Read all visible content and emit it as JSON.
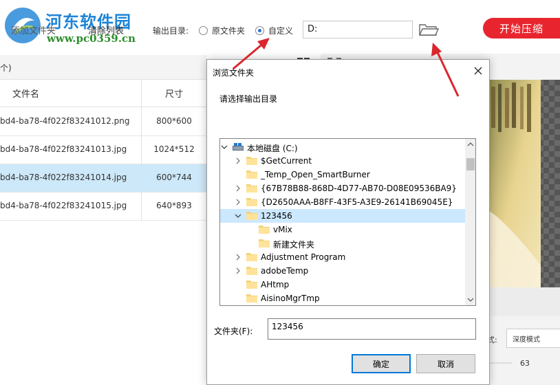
{
  "watermark": {
    "title": "河东软件园",
    "url": "www.pc0359.cn"
  },
  "toolbar": {
    "add_folder": "添加文件夹",
    "clear_list": "清除列表",
    "output_label": "输出目录:",
    "radio_original": "原文件夹",
    "radio_custom": "自定义",
    "path_value": "D:",
    "start_button": "开始压缩"
  },
  "left_panel": {
    "count_paren": "个)",
    "columns": {
      "name": "文件名",
      "size": "尺寸"
    },
    "rows": [
      {
        "name": "bd4-ba78-4f022f83241012.png",
        "size": "800*600",
        "selected": false
      },
      {
        "name": "bd4-ba78-4f022f83241013.jpg",
        "size": "1024*512",
        "selected": false
      },
      {
        "name": "bd4-ba78-4f022f83241014.jpg",
        "size": "600*744",
        "selected": true
      },
      {
        "name": "bd4-ba78-4f022f83241015.jpg",
        "size": "640*893",
        "selected": false
      }
    ]
  },
  "right_panel": {
    "mode_label": "式:",
    "mode_value": "深度模式",
    "quality_value": "63"
  },
  "dialog": {
    "title": "浏览文件夹",
    "prompt": "请选择输出目录",
    "tree": [
      {
        "label": "本地磁盘 (C:)",
        "level": 0,
        "arrow": "down",
        "icon": "drive-icon",
        "selected": false
      },
      {
        "label": "$GetCurrent",
        "level": 1,
        "arrow": "right",
        "icon": "folder-icon",
        "selected": false
      },
      {
        "label": "_Temp_Open_SmartBurner",
        "level": 1,
        "arrow": "none",
        "icon": "folder-icon",
        "selected": false
      },
      {
        "label": "{67B78B88-868D-4D77-AB70-D08E09536BA9}",
        "level": 1,
        "arrow": "right",
        "icon": "folder-icon",
        "selected": false
      },
      {
        "label": "{D2650AAA-B8FF-43F5-A3E9-26141B69045E}",
        "level": 1,
        "arrow": "right",
        "icon": "folder-icon",
        "selected": false
      },
      {
        "label": "123456",
        "level": 1,
        "arrow": "down",
        "icon": "folder-icon",
        "selected": true
      },
      {
        "label": "vMix",
        "level": 2,
        "arrow": "none",
        "icon": "folder-icon",
        "selected": false
      },
      {
        "label": "新建文件夹",
        "level": 2,
        "arrow": "none",
        "icon": "folder-icon",
        "selected": false
      },
      {
        "label": "Adjustment Program",
        "level": 1,
        "arrow": "right",
        "icon": "folder-icon",
        "selected": false
      },
      {
        "label": "adobeTemp",
        "level": 1,
        "arrow": "right",
        "icon": "folder-icon",
        "selected": false
      },
      {
        "label": "AHtmp",
        "level": 1,
        "arrow": "none",
        "icon": "folder-icon",
        "selected": false
      },
      {
        "label": "AisinoMgrTmp",
        "level": 1,
        "arrow": "none",
        "icon": "folder-icon",
        "selected": false
      }
    ],
    "folder_label": "文件夹(F):",
    "folder_value": "123456",
    "ok_button": "确定",
    "cancel_button": "取消"
  },
  "colors": {
    "accent": "#e8252e",
    "selection": "#cde8f8",
    "dialog_focus": "#0078d7",
    "annotation": "#d9272d"
  }
}
